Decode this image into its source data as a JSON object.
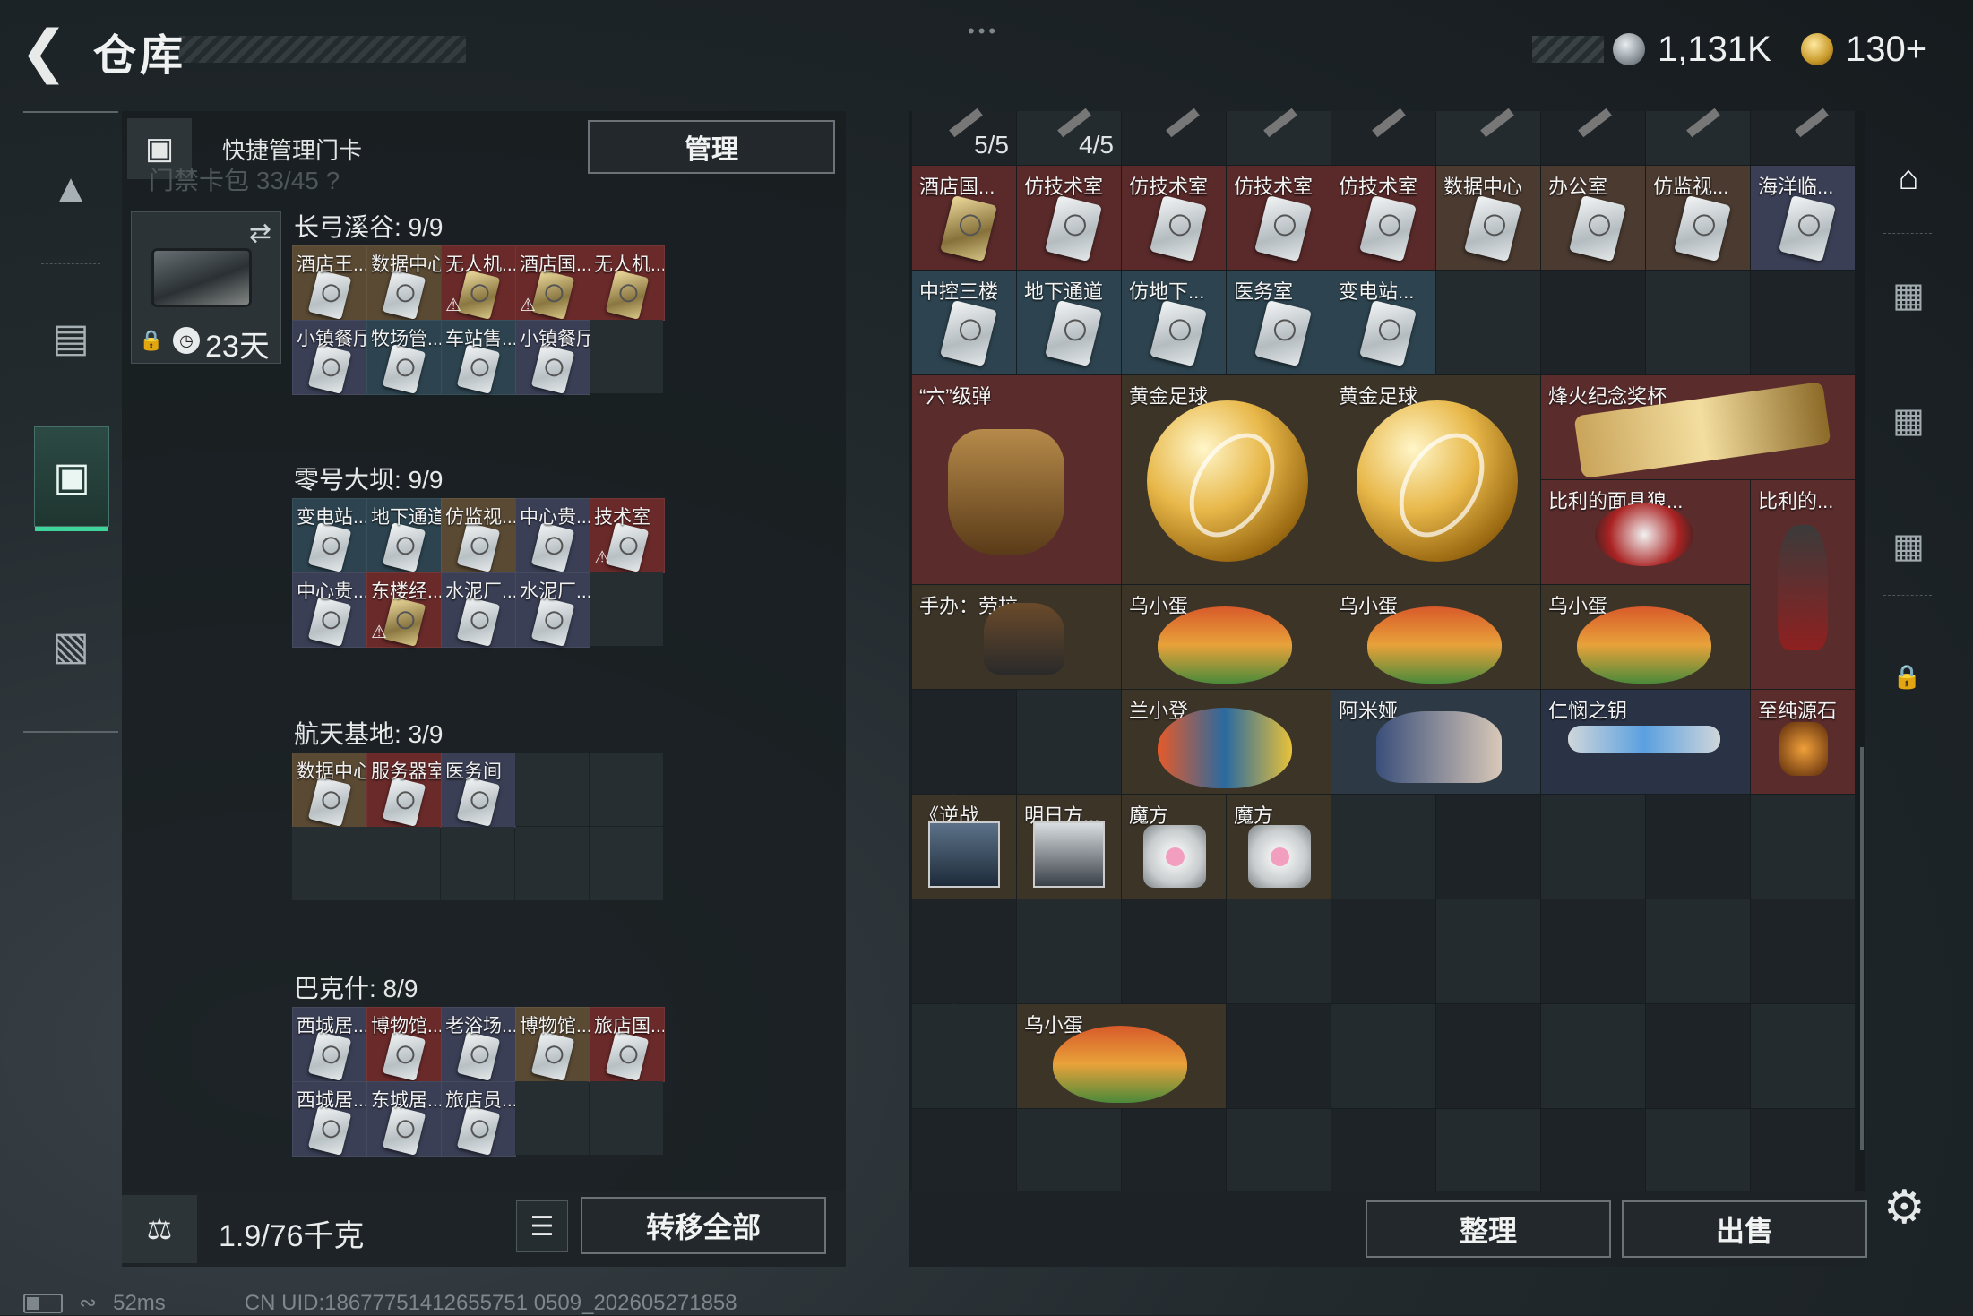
{
  "header": {
    "back_icon": "back-arrow-icon",
    "title": "仓库",
    "currency": [
      {
        "icon": "silver-coin-icon",
        "value": "1,131K"
      },
      {
        "icon": "gold-coin-icon",
        "value": "130+"
      }
    ]
  },
  "left_nav": [
    {
      "icon": "gun-icon",
      "active": false
    },
    {
      "icon": "backpack-icon",
      "active": false
    },
    {
      "icon": "keycard-icon",
      "active": true
    },
    {
      "icon": "briefcase-icon",
      "active": false
    }
  ],
  "key_panel": {
    "title": "快捷管理门卡",
    "manage_label": "管理",
    "ghost_text": "门禁卡包 33/45 ?",
    "pack_days": "23天"
  },
  "sections": [
    {
      "title": "长弓溪谷: 9/9",
      "rows": 2,
      "cells": [
        {
          "label": "酒店王...",
          "bg": "#5a4a34",
          "style": "white",
          "badge": ""
        },
        {
          "label": "数据中心",
          "bg": "#5a4a34",
          "style": "white",
          "badge": ""
        },
        {
          "label": "无人机...",
          "bg": "#6b2a2a",
          "style": "gold",
          "badge": "⚠"
        },
        {
          "label": "酒店国...",
          "bg": "#6b2a2a",
          "style": "gold",
          "badge": "⚠"
        },
        {
          "label": "无人机...",
          "bg": "#6b2a2a",
          "style": "gold",
          "badge": ""
        },
        {
          "label": "小镇餐厅",
          "bg": "#3a3f55",
          "style": "white",
          "badge": ""
        },
        {
          "label": "牧场管...",
          "bg": "#2d4450",
          "style": "white",
          "badge": ""
        },
        {
          "label": "车站售...",
          "bg": "#2d4450",
          "style": "white",
          "badge": ""
        },
        {
          "label": "小镇餐厅",
          "bg": "#3a3f55",
          "style": "white",
          "badge": ""
        }
      ]
    },
    {
      "title": "零号大坝: 9/9",
      "rows": 2,
      "cells": [
        {
          "label": "变电站...",
          "bg": "#2d4450",
          "style": "white",
          "badge": ""
        },
        {
          "label": "地下通道",
          "bg": "#2d4450",
          "style": "white",
          "badge": ""
        },
        {
          "label": "仿监视...",
          "bg": "#5a4a34",
          "style": "white",
          "badge": ""
        },
        {
          "label": "中心贵...",
          "bg": "#3a3f55",
          "style": "white",
          "badge": ""
        },
        {
          "label": "技术室",
          "bg": "#6b2a2a",
          "style": "white",
          "badge": "⚠"
        },
        {
          "label": "中心贵...",
          "bg": "#3a3f55",
          "style": "white",
          "badge": ""
        },
        {
          "label": "东楼经...",
          "bg": "#6b2a2a",
          "style": "gold",
          "badge": "⚠"
        },
        {
          "label": "水泥厂...",
          "bg": "#3a3f55",
          "style": "white",
          "badge": ""
        },
        {
          "label": "水泥厂...",
          "bg": "#3a3f55",
          "style": "white",
          "badge": ""
        }
      ]
    },
    {
      "title": "航天基地: 3/9",
      "rows": 2,
      "cells": [
        {
          "label": "数据中心",
          "bg": "#5a4a34",
          "style": "white",
          "badge": ""
        },
        {
          "label": "服务器室",
          "bg": "#6b2a2a",
          "style": "white",
          "badge": ""
        },
        {
          "label": "医务间",
          "bg": "#3a3f55",
          "style": "white",
          "badge": ""
        }
      ]
    },
    {
      "title": "巴克什: 8/9",
      "rows": 2,
      "cells": [
        {
          "label": "西城居...",
          "bg": "#3a3f55",
          "style": "white",
          "badge": ""
        },
        {
          "label": "博物馆...",
          "bg": "#6b2a2a",
          "style": "white",
          "badge": ""
        },
        {
          "label": "老浴场...",
          "bg": "#3a3f55",
          "style": "white",
          "badge": ""
        },
        {
          "label": "博物馆...",
          "bg": "#5a4a34",
          "style": "white",
          "badge": ""
        },
        {
          "label": "旅店国...",
          "bg": "#6b2a2a",
          "style": "white",
          "badge": ""
        },
        {
          "label": "西城居...",
          "bg": "#3a3f55",
          "style": "white",
          "badge": ""
        },
        {
          "label": "东城居...",
          "bg": "#3a3f55",
          "style": "white",
          "badge": ""
        },
        {
          "label": "旅店员...",
          "bg": "#3a3f55",
          "style": "white",
          "badge": ""
        }
      ]
    }
  ],
  "bottom_left": {
    "weight": "1.9/76千克",
    "transfer_label": "转移全部",
    "list_icon": "list-icon",
    "weight_icon": "weight-icon"
  },
  "top_row": [
    {
      "count": "5/5"
    },
    {
      "count": "4/5"
    },
    {
      "count": ""
    },
    {
      "count": ""
    },
    {
      "count": ""
    },
    {
      "count": ""
    },
    {
      "count": ""
    },
    {
      "count": ""
    },
    {
      "count": ""
    }
  ],
  "right_cards": [
    {
      "label": "酒店国...",
      "bg": "#5a2a2a",
      "style": "gold"
    },
    {
      "label": "仿技术室",
      "bg": "#5a2a2a",
      "style": "white"
    },
    {
      "label": "仿技术室",
      "bg": "#5a2a2a",
      "style": "white"
    },
    {
      "label": "仿技术室",
      "bg": "#5a2a2a",
      "style": "white"
    },
    {
      "label": "仿技术室",
      "bg": "#5a2a2a",
      "style": "white"
    },
    {
      "label": "数据中心",
      "bg": "#4a3a30",
      "style": "white"
    },
    {
      "label": "办公室",
      "bg": "#4a3a30",
      "style": "white"
    },
    {
      "label": "仿监视...",
      "bg": "#4a3a30",
      "style": "white"
    },
    {
      "label": "海洋临...",
      "bg": "#3a3f55",
      "style": "white"
    },
    {
      "label": "中控三楼",
      "bg": "#2d4450",
      "style": "white"
    },
    {
      "label": "地下通道",
      "bg": "#2d4450",
      "style": "white"
    },
    {
      "label": "仿地下...",
      "bg": "#2d4450",
      "style": "white"
    },
    {
      "label": "医务室",
      "bg": "#2d4450",
      "style": "white"
    },
    {
      "label": "变电站...",
      "bg": "#2d4450",
      "style": "white"
    }
  ],
  "right_items": {
    "six_bullet": "“六”级弹",
    "gold_ball_1": "黄金足球",
    "gold_ball_2": "黄金足球",
    "trophy": "烽火纪念奖杯",
    "billy_mask": "比利的面具狼...",
    "billy": "比利的...",
    "figure_lara": "手办：劳拉",
    "egg1": "乌小蛋",
    "egg2": "乌小蛋",
    "egg3": "乌小蛋",
    "lan": "兰小登",
    "amiya": "阿米娅",
    "key": "仁悯之钥",
    "stone": "至纯源石",
    "reverse": "《逆战",
    "mingri": "明日方...",
    "cube1": "魔方",
    "cube2": "魔方",
    "egg4": "乌小蛋"
  },
  "bottom_right": {
    "sort_label": "整理",
    "sell_label": "出售"
  },
  "right_nav": [
    {
      "icon": "home-icon"
    },
    {
      "icon": "storage-iv-icon"
    },
    {
      "icon": "storage-iii-icon"
    },
    {
      "icon": "storage-ii-icon"
    },
    {
      "icon": "lock-icon"
    }
  ],
  "status": {
    "ping": "52ms",
    "uid": "CN UID:18677751412655751 0509_202605271858"
  },
  "colors": {
    "accent": "#3ed49a",
    "red_bg": "#6b2a2a",
    "blue_bg": "#2d4450"
  }
}
